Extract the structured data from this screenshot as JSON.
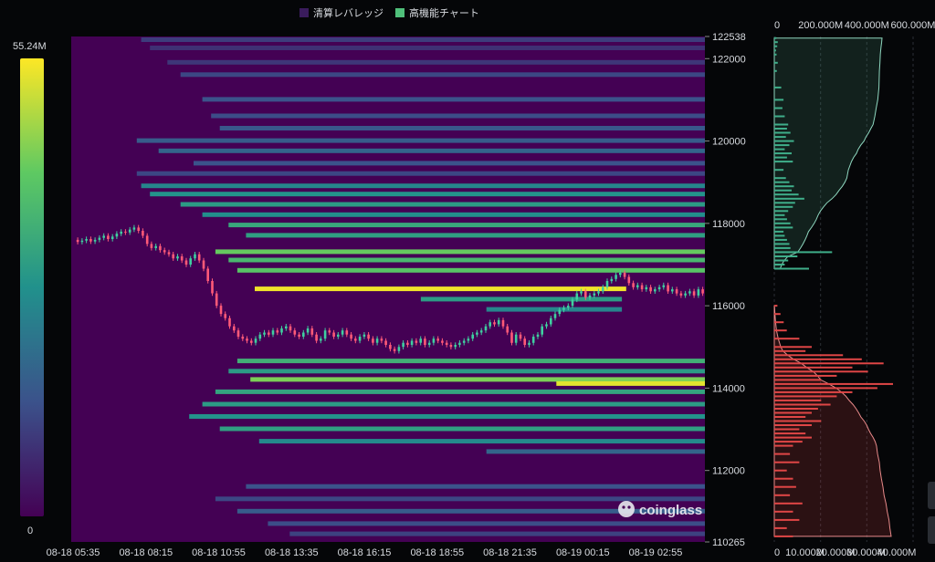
{
  "legend": {
    "items": [
      {
        "label": "清算レバレッジ",
        "color": "#3a1c5c"
      },
      {
        "label": "高機能チャート",
        "color": "#4fc07a"
      }
    ]
  },
  "colorbar": {
    "max_label": "55.24M",
    "min_label": "0"
  },
  "watermark": {
    "text": "coinglass"
  },
  "chart_data": {
    "type": "heatmap",
    "title": "",
    "x_ticks": [
      "08-18 05:35",
      "08-18 08:15",
      "08-18 10:55",
      "08-18 13:35",
      "08-18 16:15",
      "08-18 18:55",
      "08-18 21:35",
      "08-19 00:15",
      "08-19 02:55"
    ],
    "y_ticks": [
      122538,
      122000,
      120000,
      118000,
      116000,
      114000,
      112000,
      110265
    ],
    "ylim": [
      110265,
      122538
    ],
    "xlim_bars": [
      0,
      145
    ],
    "colorbar_range": [
      0,
      55.24
    ],
    "colorbar_unit": "M",
    "liquidation_bands": [
      {
        "price": 122450,
        "start_bar": 16,
        "end_bar": 145,
        "value": 10
      },
      {
        "price": 122250,
        "start_bar": 18,
        "end_bar": 145,
        "value": 8
      },
      {
        "price": 121900,
        "start_bar": 22,
        "end_bar": 145,
        "value": 9
      },
      {
        "price": 121600,
        "start_bar": 25,
        "end_bar": 145,
        "value": 12
      },
      {
        "price": 121000,
        "start_bar": 30,
        "end_bar": 145,
        "value": 14
      },
      {
        "price": 120600,
        "start_bar": 32,
        "end_bar": 145,
        "value": 13
      },
      {
        "price": 120300,
        "start_bar": 34,
        "end_bar": 145,
        "value": 15
      },
      {
        "price": 120000,
        "start_bar": 15,
        "end_bar": 145,
        "value": 16
      },
      {
        "price": 119750,
        "start_bar": 20,
        "end_bar": 145,
        "value": 18
      },
      {
        "price": 119450,
        "start_bar": 28,
        "end_bar": 145,
        "value": 14
      },
      {
        "price": 119200,
        "start_bar": 15,
        "end_bar": 145,
        "value": 12
      },
      {
        "price": 118900,
        "start_bar": 16,
        "end_bar": 145,
        "value": 25
      },
      {
        "price": 118700,
        "start_bar": 18,
        "end_bar": 145,
        "value": 28
      },
      {
        "price": 118450,
        "start_bar": 25,
        "end_bar": 145,
        "value": 30
      },
      {
        "price": 118200,
        "start_bar": 30,
        "end_bar": 145,
        "value": 27
      },
      {
        "price": 117950,
        "start_bar": 36,
        "end_bar": 145,
        "value": 33
      },
      {
        "price": 117700,
        "start_bar": 40,
        "end_bar": 145,
        "value": 31
      },
      {
        "price": 117300,
        "start_bar": 33,
        "end_bar": 145,
        "value": 42
      },
      {
        "price": 117100,
        "start_bar": 36,
        "end_bar": 145,
        "value": 37
      },
      {
        "price": 116850,
        "start_bar": 38,
        "end_bar": 145,
        "value": 40
      },
      {
        "price": 116400,
        "start_bar": 42,
        "end_bar": 127,
        "value": 54
      },
      {
        "price": 116150,
        "start_bar": 80,
        "end_bar": 126,
        "value": 30
      },
      {
        "price": 115900,
        "start_bar": 95,
        "end_bar": 126,
        "value": 25
      },
      {
        "price": 114650,
        "start_bar": 38,
        "end_bar": 145,
        "value": 35
      },
      {
        "price": 114400,
        "start_bar": 36,
        "end_bar": 145,
        "value": 30
      },
      {
        "price": 114200,
        "start_bar": 41,
        "end_bar": 145,
        "value": 44
      },
      {
        "price": 114100,
        "start_bar": 111,
        "end_bar": 145,
        "value": 53
      },
      {
        "price": 113900,
        "start_bar": 33,
        "end_bar": 145,
        "value": 32
      },
      {
        "price": 113600,
        "start_bar": 30,
        "end_bar": 145,
        "value": 30
      },
      {
        "price": 113300,
        "start_bar": 27,
        "end_bar": 145,
        "value": 28
      },
      {
        "price": 113000,
        "start_bar": 34,
        "end_bar": 145,
        "value": 31
      },
      {
        "price": 112700,
        "start_bar": 43,
        "end_bar": 145,
        "value": 26
      },
      {
        "price": 112450,
        "start_bar": 95,
        "end_bar": 145,
        "value": 18
      },
      {
        "price": 111600,
        "start_bar": 40,
        "end_bar": 145,
        "value": 14
      },
      {
        "price": 111300,
        "start_bar": 33,
        "end_bar": 145,
        "value": 12
      },
      {
        "price": 111000,
        "start_bar": 38,
        "end_bar": 145,
        "value": 16
      },
      {
        "price": 110700,
        "start_bar": 45,
        "end_bar": 145,
        "value": 13
      },
      {
        "price": 110450,
        "start_bar": 50,
        "end_bar": 145,
        "value": 11
      }
    ],
    "price_series": [
      117600,
      117550,
      117580,
      117620,
      117560,
      117600,
      117650,
      117700,
      117620,
      117680,
      117750,
      117800,
      117780,
      117850,
      117900,
      117820,
      117700,
      117500,
      117400,
      117450,
      117350,
      117300,
      117250,
      117150,
      117200,
      117100,
      117000,
      117150,
      117250,
      117100,
      116900,
      116600,
      116300,
      116000,
      115800,
      115700,
      115500,
      115400,
      115250,
      115200,
      115150,
      115100,
      115200,
      115300,
      115350,
      115300,
      115400,
      115350,
      115450,
      115500,
      115400,
      115300,
      115250,
      115350,
      115450,
      115300,
      115150,
      115200,
      115400,
      115350,
      115250,
      115300,
      115400,
      115300,
      115200,
      115150,
      115250,
      115300,
      115200,
      115100,
      115200,
      115150,
      115050,
      114950,
      114900,
      115000,
      115100,
      115050,
      115150,
      115100,
      115200,
      115050,
      115100,
      115200,
      115150,
      115100,
      115050,
      115000,
      115050,
      115100,
      115150,
      115200,
      115300,
      115350,
      115400,
      115500,
      115600,
      115550,
      115650,
      115500,
      115350,
      115100,
      115300,
      115200,
      115050,
      115100,
      115250,
      115300,
      115500,
      115550,
      115700,
      115800,
      115900,
      115950,
      116000,
      116150,
      116300,
      116350,
      116200,
      116250,
      116300,
      116350,
      116450,
      116600,
      116650,
      116750,
      116800,
      116700,
      116550,
      116450,
      116500,
      116400,
      116450,
      116350,
      116400,
      116450,
      116500,
      116350,
      116400,
      116300,
      116250,
      116300,
      116350,
      116250,
      116400,
      116300
    ],
    "top_axis": {
      "labels": [
        "0",
        "200.000M",
        "400.000M",
        "600.000M"
      ],
      "max": 600
    },
    "bottom_axis": {
      "labels": [
        "0",
        "10.000M",
        "20.000M",
        "30.000M",
        "40.000M"
      ],
      "max": 40
    },
    "short_profile": {
      "prices": [
        122500,
        122400,
        122300,
        122200,
        122100,
        121900,
        121700,
        121300,
        121000,
        120800,
        120600,
        120400,
        120300,
        120200,
        120100,
        120000,
        119900,
        119800,
        119700,
        119600,
        119500,
        119300,
        119100,
        119000,
        118900,
        118800,
        118700,
        118600,
        118500,
        118400,
        118300,
        118200,
        118100,
        118000,
        117900,
        117800,
        117700,
        117600,
        117500,
        117400,
        117300,
        117200,
        117100,
        117000,
        116900
      ],
      "values": [
        18,
        30,
        25,
        15,
        20,
        30,
        22,
        60,
        80,
        70,
        90,
        120,
        110,
        140,
        100,
        170,
        130,
        90,
        150,
        110,
        160,
        80,
        100,
        130,
        170,
        150,
        210,
        260,
        180,
        160,
        120,
        90,
        110,
        140,
        160,
        80,
        90,
        110,
        130,
        140,
        500,
        200,
        120,
        90,
        300
      ],
      "cumulative_right": 1000
    },
    "long_profile": {
      "prices": [
        116000,
        115800,
        115600,
        115400,
        115200,
        115000,
        114900,
        114800,
        114700,
        114600,
        114500,
        114400,
        114300,
        114200,
        114100,
        114000,
        113900,
        113800,
        113700,
        113600,
        113500,
        113400,
        113300,
        113200,
        113100,
        113000,
        112900,
        112800,
        112700,
        112600,
        112400,
        112200,
        112000,
        111800,
        111600,
        111400,
        111200,
        111000,
        110800,
        110600,
        110400
      ],
      "values": [
        1,
        2,
        3,
        4,
        8,
        12,
        10,
        22,
        28,
        35,
        25,
        30,
        20,
        15,
        38,
        33,
        25,
        20,
        15,
        18,
        14,
        12,
        10,
        15,
        12,
        8,
        10,
        12,
        9,
        6,
        5,
        8,
        4,
        6,
        7,
        5,
        9,
        6,
        8,
        4,
        6
      ]
    }
  }
}
